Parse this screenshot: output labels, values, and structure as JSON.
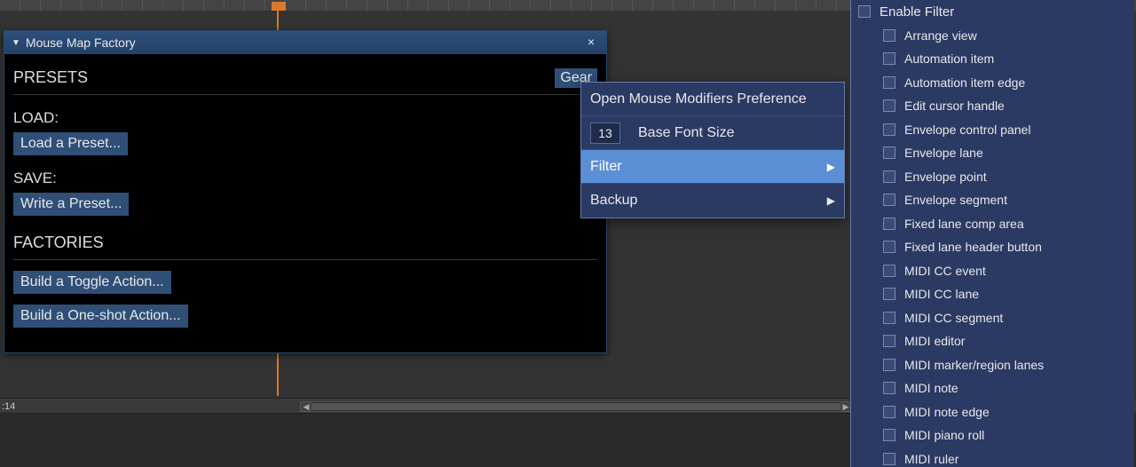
{
  "window": {
    "title": "Mouse Map Factory"
  },
  "presets_header": "PRESETS",
  "gear_label": "Gear",
  "load_label": "LOAD:",
  "load_button": "Load a Preset...",
  "save_label": "SAVE:",
  "save_button": "Write a Preset...",
  "factories_header": "FACTORIES",
  "factory_buttons": {
    "toggle": "Build a Toggle Action...",
    "oneshot": "Build a One-shot Action..."
  },
  "gear_menu": {
    "open_pref": "Open Mouse Modifiers Preference",
    "font_size_label": "Base Font Size",
    "font_size_value": "13",
    "filter": "Filter",
    "backup": "Backup"
  },
  "filter_panel": {
    "enable": "Enable Filter",
    "items": [
      "Arrange view",
      "Automation item",
      "Automation item edge",
      "Edit cursor handle",
      "Envelope control panel",
      "Envelope lane",
      "Envelope point",
      "Envelope segment",
      "Fixed lane comp area",
      "Fixed lane header button",
      "MIDI CC event",
      "MIDI CC lane",
      "MIDI CC segment",
      "MIDI editor",
      "MIDI marker/region lanes",
      "MIDI note",
      "MIDI note edge",
      "MIDI piano roll",
      "MIDI ruler"
    ]
  },
  "timeline": {
    "bottom_time": ":14"
  }
}
